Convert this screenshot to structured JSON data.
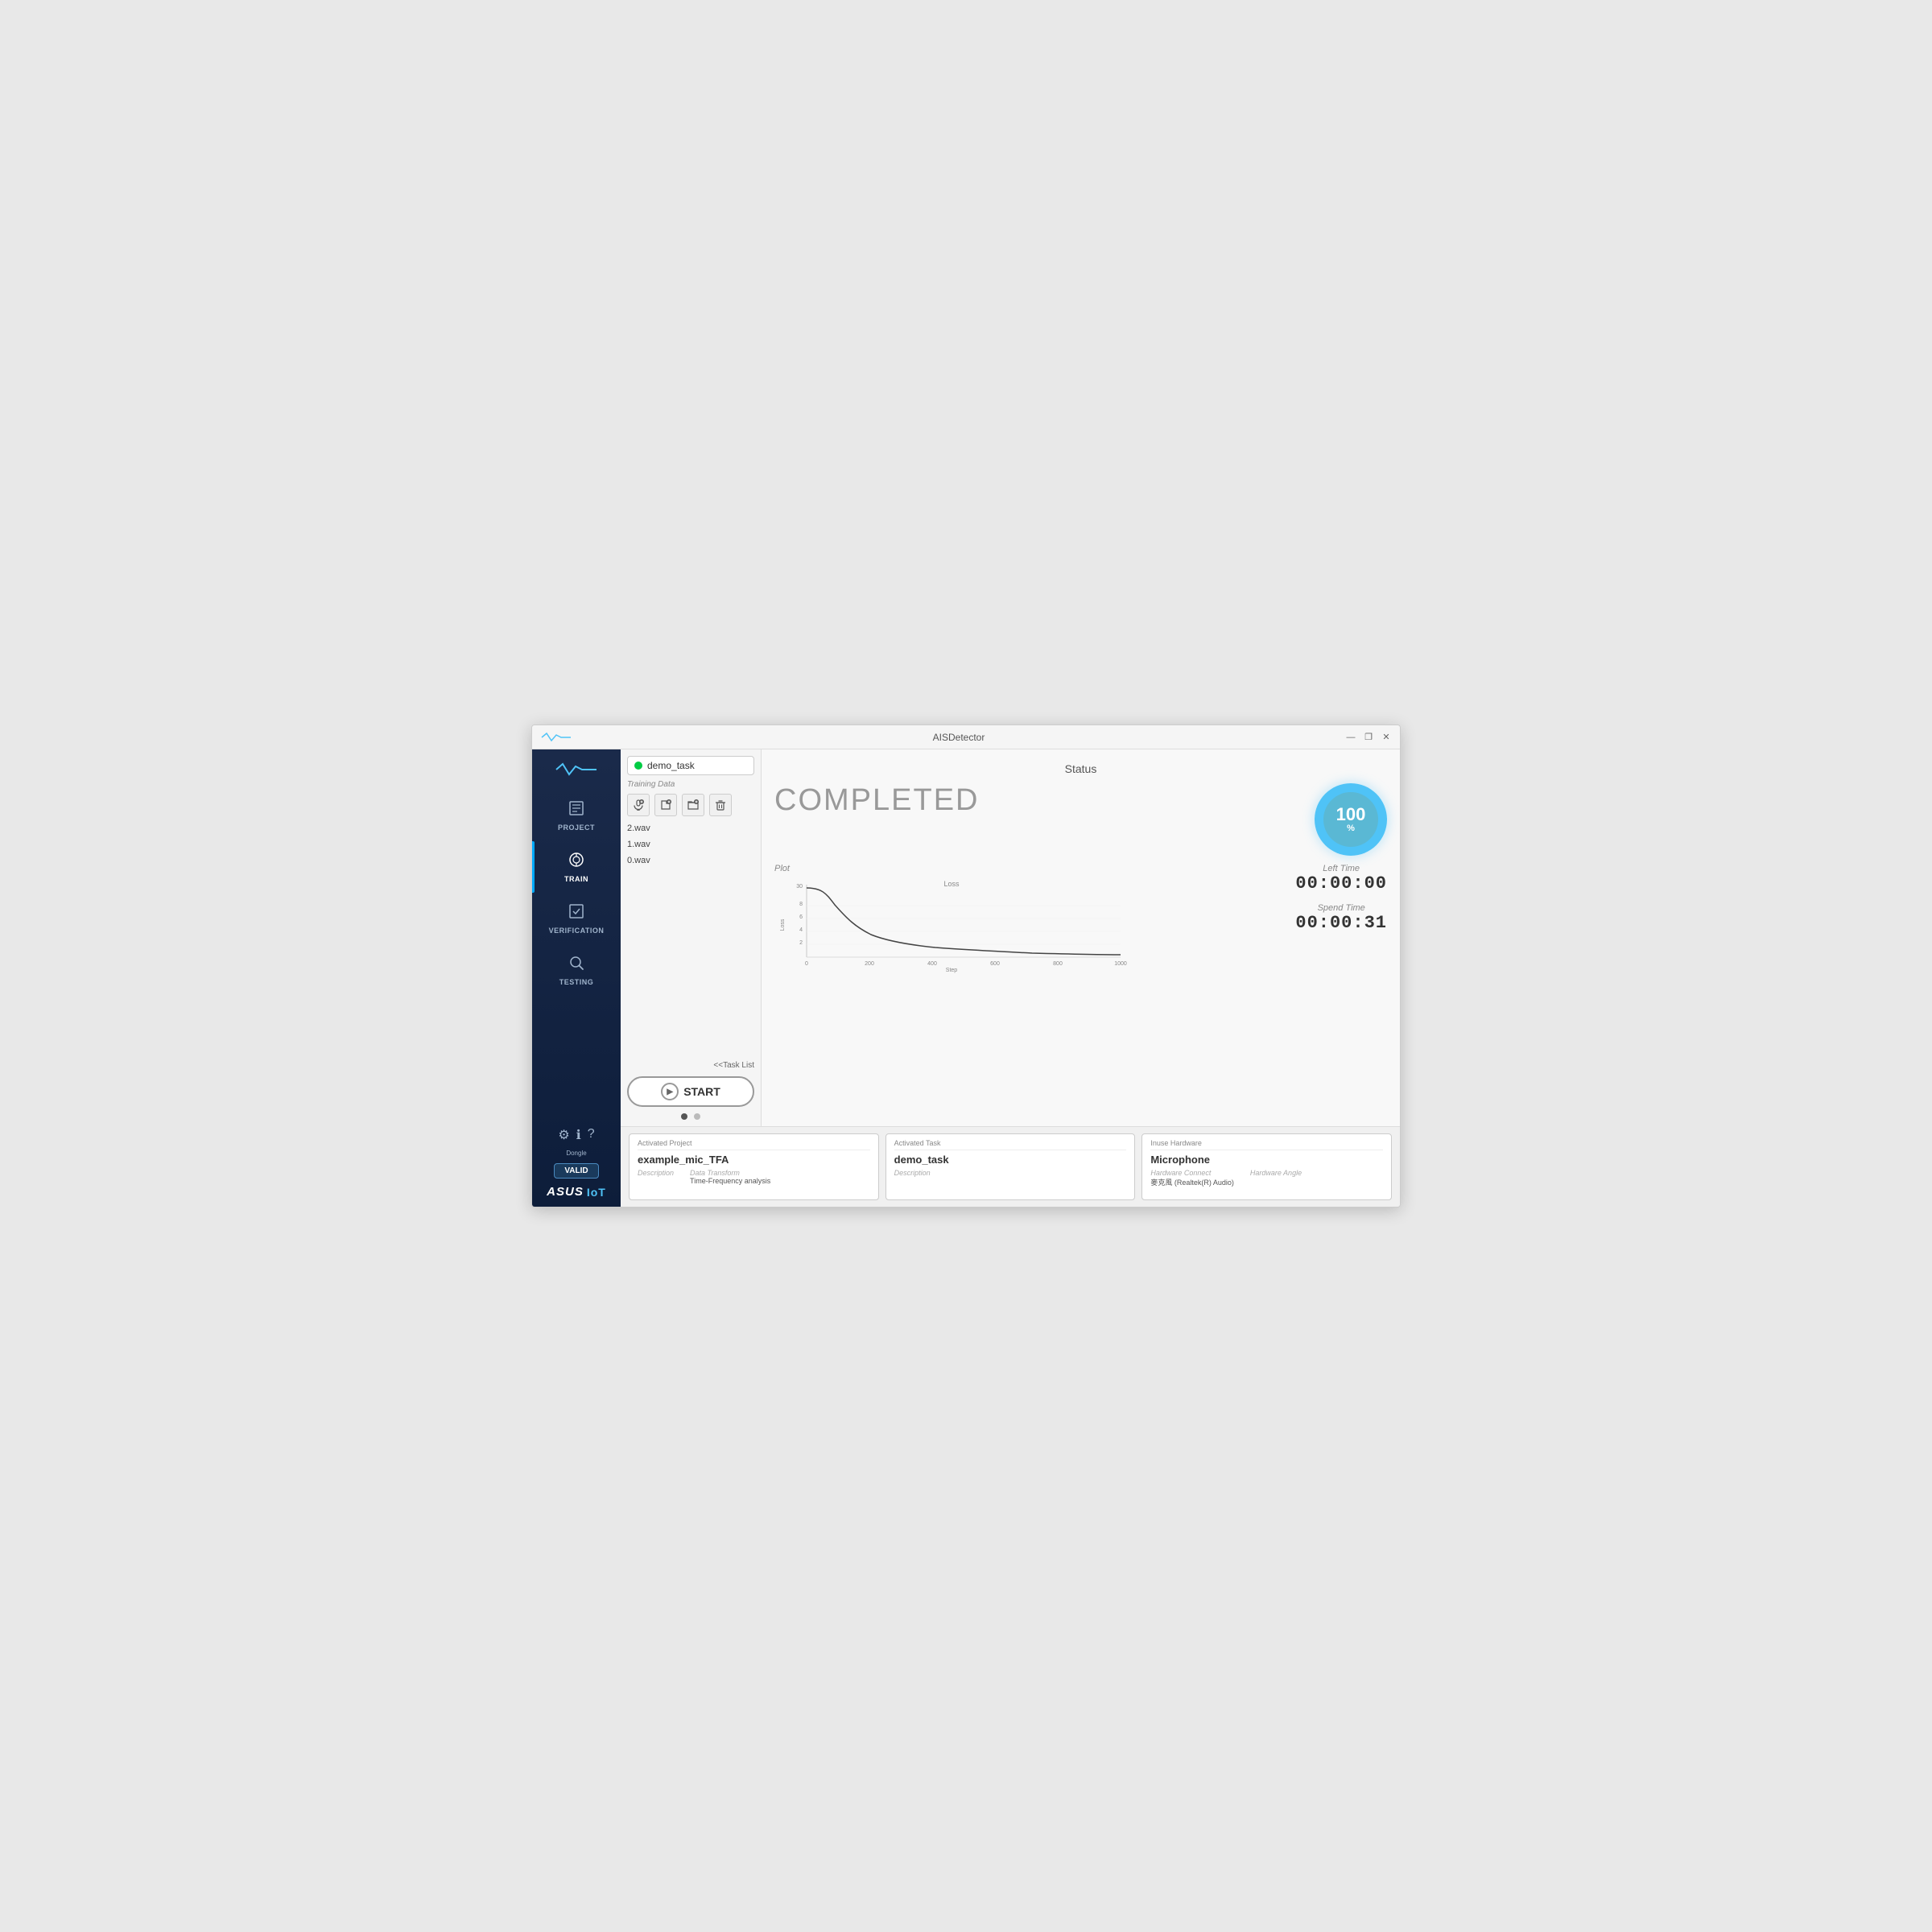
{
  "window": {
    "title": "AISDetector",
    "minimize_btn": "—",
    "maximize_btn": "❐",
    "close_btn": "✕"
  },
  "sidebar": {
    "logo_wave": "∿",
    "items": [
      {
        "id": "project",
        "label": "PROJECT",
        "icon": "📋",
        "active": false
      },
      {
        "id": "train",
        "label": "TRAIN",
        "icon": "🧠",
        "active": true
      },
      {
        "id": "verification",
        "label": "VERIFICATION",
        "icon": "📄",
        "active": false
      },
      {
        "id": "testing",
        "label": "TESTING",
        "icon": "🔍",
        "active": false
      }
    ],
    "dongle_label": "Dongle",
    "valid_badge": "VALID",
    "asus_iot": "ASUS IoT"
  },
  "task_panel": {
    "task_name": "demo_task",
    "training_data_label": "Training Data",
    "wav_files": [
      "2.wav",
      "1.wav",
      "0.wav"
    ],
    "task_list_btn": "<<Task List",
    "start_btn": "START",
    "icons": [
      "mic-add-icon",
      "file-add-icon",
      "folder-add-icon",
      "delete-icon"
    ]
  },
  "status": {
    "title": "Status",
    "completed_text": "COMPLETED",
    "progress_value": "100",
    "progress_unit": "%",
    "left_time_label": "Left Time",
    "left_time": "00:00:00",
    "spend_time_label": "Spend Time",
    "spend_time": "00:00:31",
    "plot_label": "Plot",
    "chart": {
      "title": "Loss",
      "x_label": "Step",
      "y_label": "Loss",
      "x_ticks": [
        "0",
        "200",
        "400",
        "600",
        "800",
        "1000"
      ],
      "y_ticks": [
        "30",
        "8",
        "6",
        "4",
        "2"
      ],
      "curve": "exponential_decay"
    }
  },
  "bottom_bar": {
    "activated_project": {
      "header": "Activated Project",
      "title": "example_mic_TFA",
      "key1": "Description",
      "val1": "",
      "key2": "Data Transform",
      "val2": "Time-Frequency analysis"
    },
    "activated_task": {
      "header": "Activated Task",
      "title": "demo_task",
      "key1": "Description",
      "val1": ""
    },
    "inuse_hardware": {
      "header": "Inuse Hardware",
      "title": "Microphone",
      "key1": "Hardware Connect",
      "val1": "麥克風 (Realtek(R) Audio)",
      "key2": "Hardware Angle",
      "val2": ""
    }
  }
}
